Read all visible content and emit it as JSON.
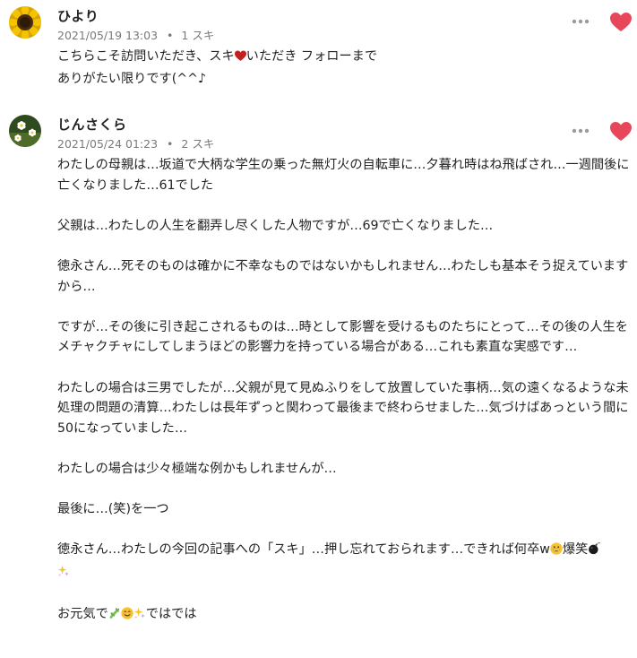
{
  "comments": [
    {
      "author": "ひより",
      "date": "2021/05/19 13:03",
      "likes": "1 スキ",
      "avatar_icon": "sunflower-avatar",
      "more_icon": "more-options-icon",
      "heart_icon": "heart-liked-icon",
      "heart_color": "#e8465a",
      "lines": [
        {
          "a": "こちらこそ訪問いただき、スキ",
          "icon": "red-heart-emoji",
          "b": "いただき フォローまで"
        },
        {
          "a": "ありがたい限りです(^^♪"
        }
      ]
    },
    {
      "author": "じんさくら",
      "date": "2021/05/24 01:23",
      "likes": "2 スキ",
      "avatar_icon": "flower-avatar",
      "more_icon": "more-options-icon",
      "heart_icon": "heart-liked-icon",
      "heart_color": "#e8465a",
      "paragraphs": [
        "わたしの母親は…坂道で大柄な学生の乗った無灯火の自転車に…夕暮れ時はね飛ばされ…一週間後に亡くなりました…61でした",
        "父親は…わたしの人生を翻弄し尽くした人物ですが…69で亡くなりました…",
        "徳永さん…死そのものは確かに不幸なものではないかもしれません…わたしも基本そう捉えていますから…",
        "ですが…その後に引き起こされるものは…時として影響を受けるものたちにとって…その後の人生をメチャクチャにしてしまうほどの影響力を持っている場合がある…これも素直な実感です…",
        "わたしの場合は三男でしたが…父親が見て見ぬふりをして放置していた事柄…気の遠くなるような未処理の問題の清算…わたしは長年ずっと関わって最後まで終わらせました…気づけばあっという間に50になっていました…",
        "わたしの場合は少々極端な例かもしれませんが…",
        "最後に…(笑)を一つ"
      ],
      "closing_1": {
        "text_a": "徳永さん…わたしの今回の記事への「スキ」…押し忘れておられます…できれば何卒w",
        "icon_1": "grinning-face-emoji",
        "text_b": "爆笑",
        "icon_2": "bomb-emoji",
        "icon_3": "sparkles-emoji"
      },
      "closing_2": {
        "text_a": "お元気で",
        "icon_1": "herb-emoji",
        "icon_2": "smiling-face-emoji",
        "icon_3": "sparkles-emoji",
        "text_b": "ではでは"
      }
    }
  ]
}
